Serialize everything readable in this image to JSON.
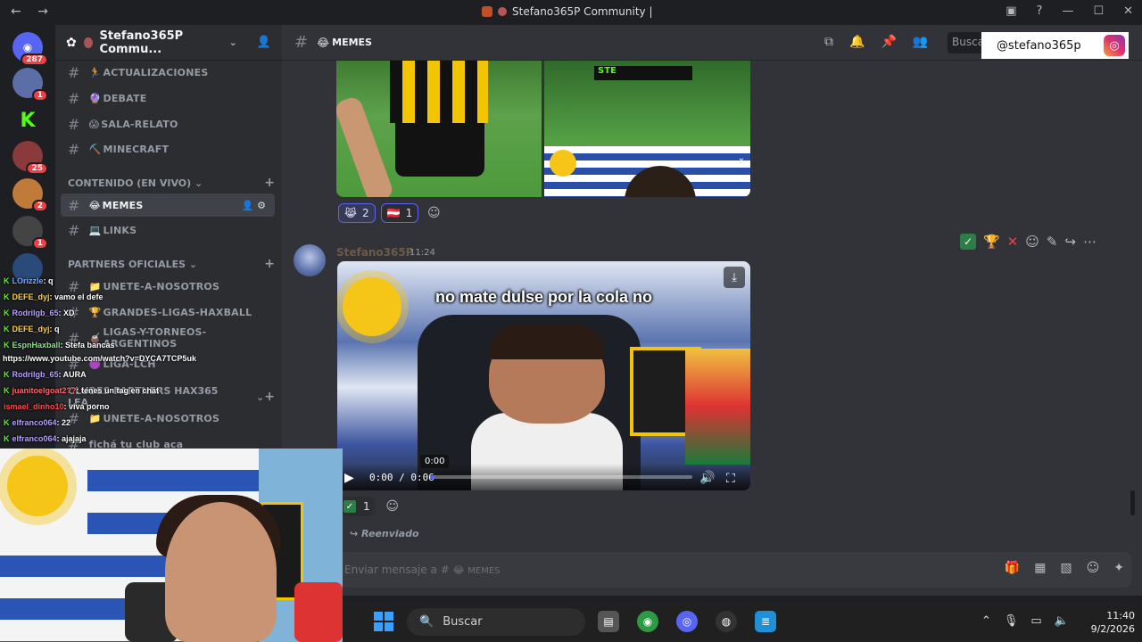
{
  "window": {
    "title": "Stefano365P Community | ",
    "nav_back": "←",
    "nav_forward": "→"
  },
  "rail": {
    "items": [
      {
        "badge": "287"
      },
      {
        "badge": "1"
      },
      {
        "badge": ""
      },
      {
        "badge": "25"
      },
      {
        "badge": "2"
      },
      {
        "badge": "1"
      },
      {
        "badge": ""
      }
    ]
  },
  "server": {
    "name": "Stefano365P Commu..."
  },
  "sidebar": {
    "channels_top": [
      {
        "emoji": "🏃",
        "name": "ACTUALIZACIONES"
      },
      {
        "emoji": "🔮",
        "name": "DEBATE"
      },
      {
        "emoji": "😱",
        "name": "SALA-RELATO"
      },
      {
        "emoji": "⛏️",
        "name": "MINECRAFT"
      }
    ],
    "category_live": "CONTENIDO (EN VIVO)",
    "channels_live": [
      {
        "emoji": "😂",
        "name": "MEMES"
      },
      {
        "emoji": "💻",
        "name": "LINKS"
      }
    ],
    "category_partners": "PARTNERS OFICIALES",
    "channels_partners": [
      {
        "emoji": "📁",
        "name": "UNETE-A-NOSOTROS"
      },
      {
        "emoji": "🏆",
        "name": "GRANDES-LIGAS-HAXBALL"
      },
      {
        "emoji": "🧉",
        "name": "LIGAS-Y-TORNEOS-ARGENTINOS"
      },
      {
        "emoji": "🟣",
        "name": "LIGA-LCH"
      }
    ],
    "category_clubes": "CLUBES PARTNERS HAX365 LEA...",
    "channels_clubes": [
      {
        "emoji": "📁",
        "name": "UNETE-A-NOSOTROS"
      },
      {
        "emoji": "",
        "name": "fichá tu club aca"
      }
    ]
  },
  "chat_overlay": {
    "lines": [
      {
        "user": "LOrizzle",
        "msg": ": q"
      },
      {
        "user": "DEFE_dyj",
        "msg": ": vamo el defe"
      },
      {
        "user": "Rodrilgb_65",
        "msg": ": XD"
      },
      {
        "user": "DEFE_dyj",
        "msg": ": q"
      },
      {
        "user": "EspnHaxball",
        "msg": ": Stefa bancas"
      },
      {
        "user": "",
        "msg": "https://www.youtube.com/watch?v=DYCA7TCP5uk"
      },
      {
        "user": "Rodrilgb_65",
        "msg": ": AURA"
      },
      {
        "user": "juanitoelgoat2??",
        "msg": ": tenes un tag en chat"
      },
      {
        "user": "ismael_dinho10",
        "msg": ": viva porno"
      },
      {
        "user": "elfranco064",
        "msg": ": 22"
      },
      {
        "user": "elfranco064",
        "msg": ": ajajaja"
      }
    ]
  },
  "channel": {
    "name": "MEMES",
    "search_placeholder": "Busca",
    "instagram_handle": "@stefano365p"
  },
  "message1": {
    "reactions": [
      {
        "emoji": "😹",
        "count": "2"
      },
      {
        "emoji": "🇦🇹",
        "count": "1"
      }
    ],
    "overlay_text": "STE"
  },
  "message2": {
    "author": "Stefano365P",
    "time": "11:24",
    "video_caption": "no mate dulse por la cola no",
    "video_time": "0:00 / 0:06",
    "tooltip": "0:00",
    "progress": 0.02,
    "reactions": [
      {
        "emoji": "✅",
        "count": "1"
      }
    ],
    "forwarded": "Reenviado"
  },
  "composer": {
    "placeholder": "Enviar mensaje a # ",
    "channel": "MEMES"
  },
  "taskbar": {
    "search": "Buscar",
    "time": "11:40",
    "date": "9/2/2026"
  },
  "colors": {
    "accent": "#5865f2",
    "kick_green": "#53fc18",
    "danger": "#f23f43"
  }
}
